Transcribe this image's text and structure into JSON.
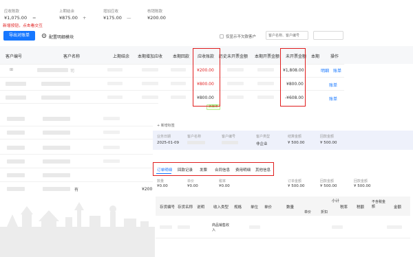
{
  "summary": [
    {
      "label": "应收账款",
      "value": "¥1,075.00",
      "op": "="
    },
    {
      "label": "上期结余",
      "value": "¥875.00",
      "op": "+"
    },
    {
      "label": "增加应收",
      "value": "¥175.00",
      "op": "—"
    },
    {
      "label": "核销账款",
      "value": "¥200.00",
      "op": ""
    }
  ],
  "annotation_note": "新增按钮，点击看交互",
  "toolbar": {
    "export_label": "导出对账单",
    "config_label": "配置明细模块",
    "checkbox_label": "仅显示不欠款客户",
    "search1_placeholder": "客户名称、客户编号",
    "search2_placeholder": ""
  },
  "table": {
    "columns": [
      "客户编号",
      "客户名称",
      "上期结余",
      "本期增加应收",
      "本期回款",
      "应收账款",
      "历史未开票金额",
      "本期开票金额",
      "未开票金额",
      "本期",
      "操作"
    ],
    "rows": [
      {
        "name_suffix": "司",
        "receivable": "¥200.00",
        "uninvoiced": "¥1,808.00",
        "actions": [
          "明细",
          "账单"
        ]
      },
      {
        "name_suffix": "",
        "receivable": "¥800.00",
        "uninvoiced": "¥800.00",
        "actions": [
          "账单"
        ]
      },
      {
        "name_suffix": "",
        "receivable": "¥800.00",
        "uninvoiced": "-¥608.00",
        "actions": [
          "账单"
        ]
      }
    ],
    "lower_rows": [
      {
        "name_suffix": "",
        "receivable": "",
        "uninvoiced": ""
      },
      {
        "name_suffix": "",
        "receivable": "",
        "uninvoiced": ""
      },
      {
        "name_suffix": "",
        "receivable": "",
        "uninvoiced": ""
      },
      {
        "name_suffix": "有",
        "receivable": "¥200",
        "uninvoiced": ""
      },
      {
        "name_suffix": "",
        "receivable": "",
        "uninvoiced": ""
      }
    ],
    "green_tag": "关联项"
  },
  "detail": {
    "add_tag": "+ 新增标签",
    "info_labels": [
      "业务日期",
      "客户名称",
      "客户编号",
      "客户类型",
      "结算金额",
      "回款金额"
    ],
    "info_values": [
      "2025-01-09",
      "",
      "",
      "非企业",
      "¥ 500.00",
      "¥ 500.00"
    ],
    "tabs": [
      "订单明细",
      "回款记录",
      "发票",
      "合同信息",
      "费用明细",
      "其他信息"
    ],
    "stats": [
      {
        "label": "数量",
        "value": "¥0.00"
      },
      {
        "label": "单价",
        "value": "¥0.00"
      },
      {
        "label": "税率",
        "value": "¥0.00"
      },
      {
        "label": "订单金额",
        "value": "¥ 500.00"
      },
      {
        "label": "回款金额",
        "value": "¥ 500.00"
      },
      {
        "label": "回款金额",
        "value": "¥ 500.00"
      }
    ],
    "grid_headers": [
      "存货编号",
      "存货名称",
      "说明",
      "收入类型",
      "规格",
      "单位",
      "单价",
      "数量",
      "小计",
      "税率",
      "税额",
      "不含税金额",
      "金额"
    ],
    "grid_subheaders": [
      "单价",
      "折扣",
      "税率",
      "税额"
    ],
    "grid_cell": "商品销售收入"
  },
  "colors": {
    "accent": "#1677ff",
    "highlight": "#e01b1b",
    "tag_green": "#52c41a"
  }
}
